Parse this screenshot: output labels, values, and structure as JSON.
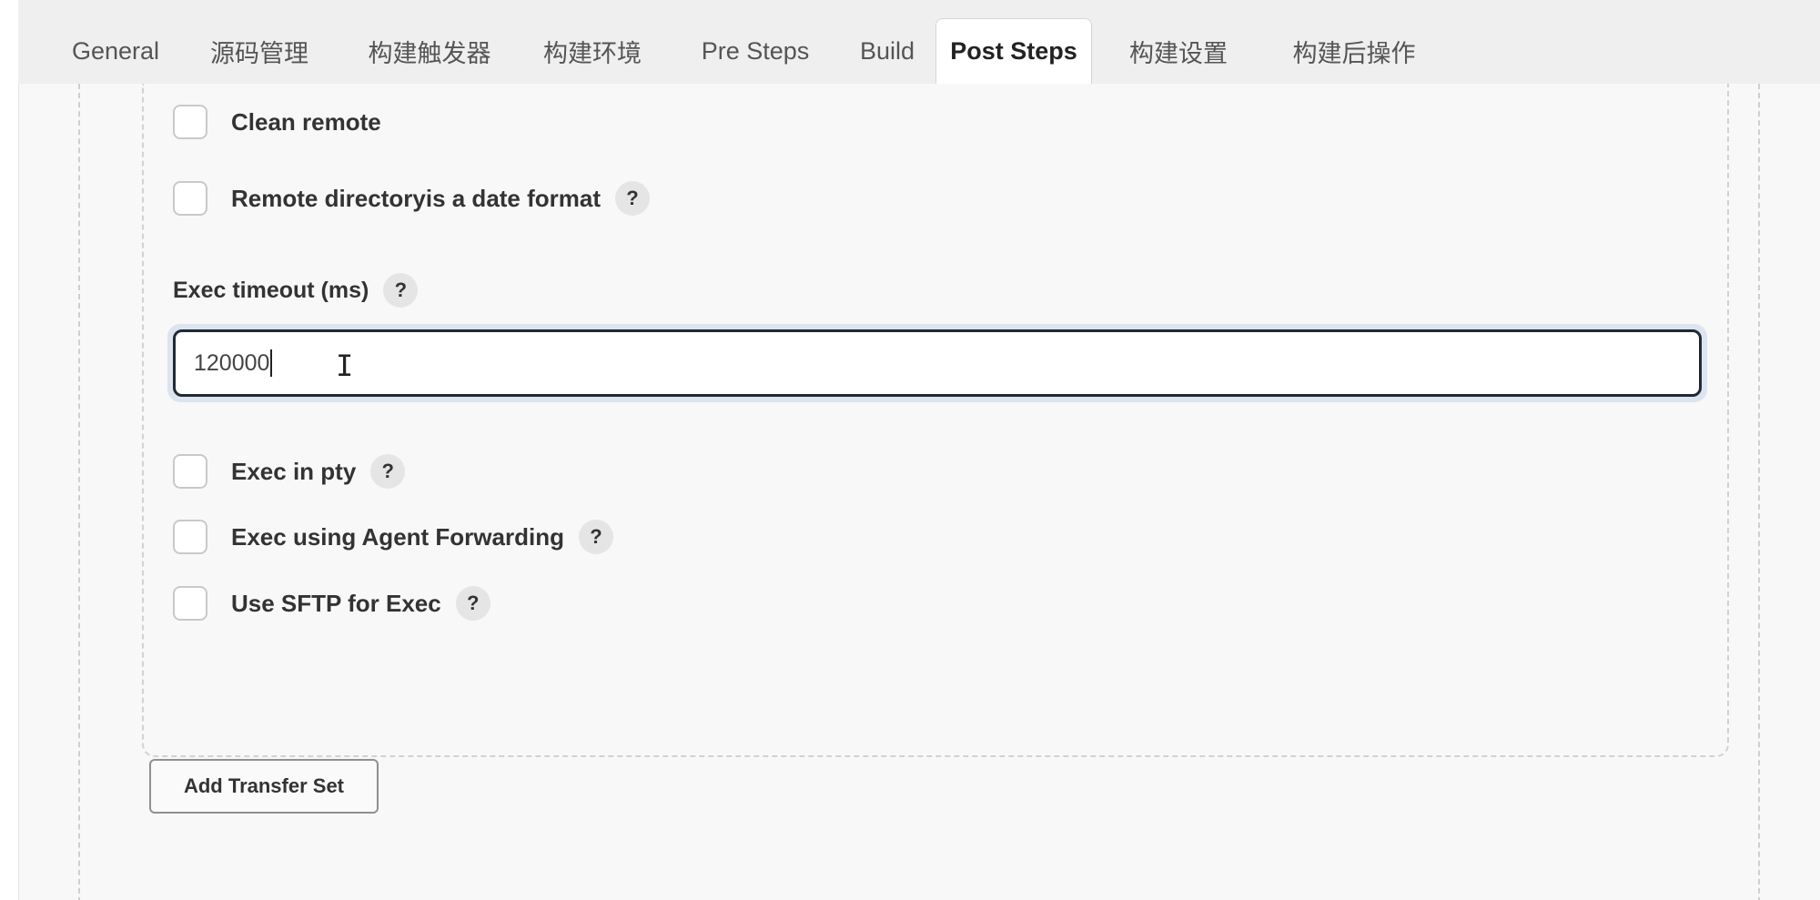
{
  "tabs": [
    {
      "label": "General"
    },
    {
      "label": "源码管理"
    },
    {
      "label": "构建触发器"
    },
    {
      "label": "构建环境"
    },
    {
      "label": "Pre Steps"
    },
    {
      "label": "Build"
    },
    {
      "label": "Post Steps",
      "active": true
    },
    {
      "label": "构建设置"
    },
    {
      "label": "构建后操作"
    }
  ],
  "options": {
    "clean_remote": "Clean remote",
    "remote_date_format": "Remote directoryis a date format",
    "exec_in_pty": "Exec in pty",
    "exec_agent_forwarding": "Exec using Agent Forwarding",
    "use_sftp": "Use SFTP for Exec"
  },
  "exec_timeout": {
    "label": "Exec timeout (ms)",
    "value": "120000"
  },
  "help_glyph": "?",
  "add_transfer_set_label": "Add Transfer Set"
}
